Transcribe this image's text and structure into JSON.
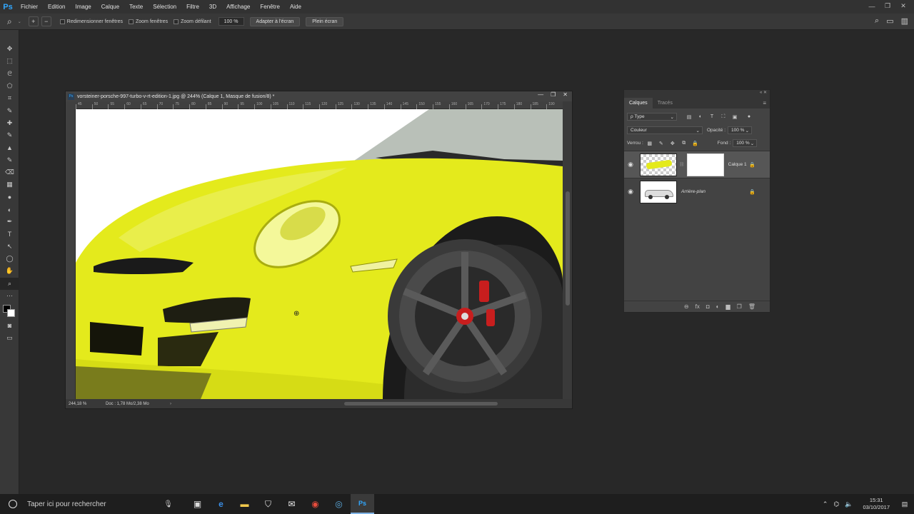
{
  "app": {
    "logo": "Ps",
    "menu": [
      "Fichier",
      "Edition",
      "Image",
      "Calque",
      "Texte",
      "Sélection",
      "Filtre",
      "3D",
      "Affichage",
      "Fenêtre",
      "Aide"
    ],
    "window_controls": [
      "—",
      "❐",
      "✕"
    ]
  },
  "options": {
    "zoom_icon": "zoom-icon",
    "zoom_in": "+",
    "zoom_out": "−",
    "check1": "Redimensionner fenêtres",
    "check2": "Zoom fenêtres",
    "check3": "Zoom défilant",
    "zoom_value": "100 %",
    "btn_fit": "Adapter à l'écran",
    "btn_full": "Plein écran",
    "right_icons": [
      "⌕",
      "▭",
      "▥"
    ]
  },
  "tools": [
    "✥",
    "⬚",
    "ᘓ",
    "⬠",
    "⌗",
    "✎",
    "✚",
    "✎",
    "▲",
    "✎",
    "⌫",
    "▦",
    "●",
    "◐",
    "✒",
    "T",
    "↖",
    "◯",
    "✋",
    "⌕",
    "⋯"
  ],
  "document": {
    "title": "vorsteiner-porsche-997-turbo-v-rt-edition-1.jpg @ 244% (Calque 1, Masque de fusion/8) *",
    "ps_badge": "Ps",
    "controls": [
      "—",
      "❐",
      "✕"
    ],
    "ruler_ticks": [
      "45",
      "50",
      "55",
      "60",
      "65",
      "70",
      "75",
      "80",
      "85",
      "90",
      "95",
      "100",
      "105",
      "110",
      "115",
      "120",
      "125",
      "130",
      "135",
      "140",
      "145",
      "150",
      "155",
      "160",
      "165",
      "170",
      "175",
      "180",
      "185",
      "190"
    ],
    "zoom": "244,18 %",
    "doc_size": "Doc : 1,78 Mo/2,38 Mo"
  },
  "layers_panel": {
    "tabs": [
      "Calques",
      "Tracés"
    ],
    "filter": "ρ Type",
    "blend_mode": "Couleur",
    "opacity_label": "Opacité :",
    "opacity_value": "100 %",
    "lock_label": "Verrou :",
    "fill_label": "Fond :",
    "fill_value": "100 %",
    "layers": [
      {
        "name": "Calque 1",
        "selected": true
      },
      {
        "name": "Arrière-plan",
        "selected": false
      }
    ],
    "bottom_icons": [
      "⊖",
      "fx",
      "◘",
      "◐",
      "▆",
      "❐",
      "🗑"
    ]
  },
  "taskbar": {
    "search_placeholder": "Taper ici pour rechercher",
    "time": "15:31",
    "date": "03/10/2017"
  },
  "colors": {
    "car_yellow": "#e4ea1c",
    "ps_blue": "#31a8ff"
  }
}
